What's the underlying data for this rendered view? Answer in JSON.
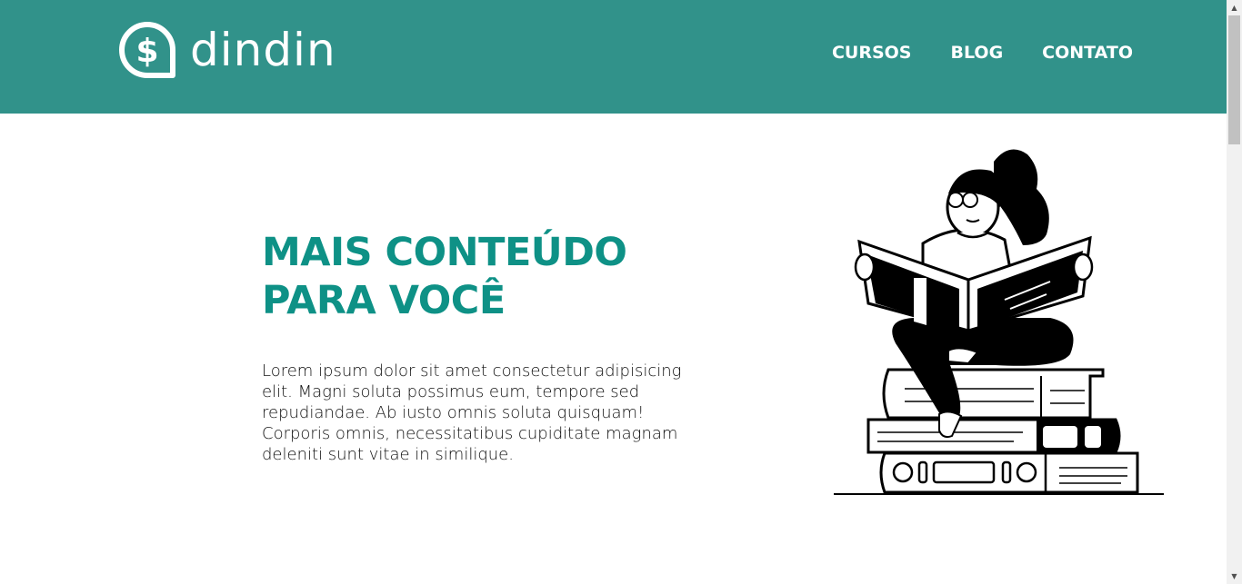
{
  "header": {
    "brand": "dindin",
    "logo_icon": "dollar-chat-bubble-icon",
    "nav": [
      {
        "label": "CURSOS"
      },
      {
        "label": "BLOG"
      },
      {
        "label": "CONTATO"
      }
    ],
    "background_color": "#31928a"
  },
  "hero": {
    "title_line1": "MAIS CONTEÚDO",
    "title_line2": "PARA VOCÊ",
    "title_color": "#0e9186",
    "text": "Lorem ipsum dolor sit amet consectetur adipisicing elit. Magni soluta possimus eum, tempore sed repudiandae. Ab iusto omnis soluta quisquam! Corporis omnis, necessitatibus cupiditate magnam deleniti sunt vitae in similique.",
    "illustration": "girl-reading-on-books-illustration"
  }
}
